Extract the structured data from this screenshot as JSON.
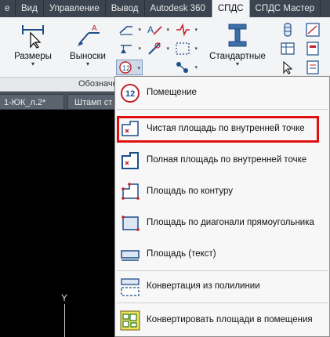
{
  "tabs": [
    "е",
    "Вид",
    "Управление",
    "Вывод",
    "Autodesk 360",
    "СПДС",
    "СПДС Мастер"
  ],
  "active_tab": "СПДС",
  "ribbon": {
    "sizes_label": "Размеры",
    "callouts_label": "Выноски",
    "standard_label": "Стандартные",
    "group_label": "Обозначен"
  },
  "doc_tabs": [
    "1-ЮК_л.2*",
    "Штамп ст"
  ],
  "ucs_label": "Y",
  "menu": {
    "items": [
      {
        "label": "Помещение",
        "icon": "room-icon"
      },
      {
        "label": "Чистая площадь по внутренней точке",
        "icon": "net-area-point-icon"
      },
      {
        "label": "Полная площадь по внутренней точке",
        "icon": "full-area-point-icon"
      },
      {
        "label": "Площадь по контуру",
        "icon": "area-contour-icon"
      },
      {
        "label": "Площадь по диагонали прямоугольника",
        "icon": "area-diagonal-icon"
      },
      {
        "label": "Площадь (текст)",
        "icon": "area-text-icon"
      },
      {
        "label": "Конвертация из полилинии",
        "icon": "convert-polyline-icon"
      },
      {
        "label": "Конвертировать площади в помещения",
        "icon": "convert-areas-icon"
      }
    ],
    "highlighted_index": 1
  },
  "colors": {
    "highlight": "#e01010",
    "tab_bar": "#3c4450",
    "ribbon": "#f3f4f6"
  }
}
